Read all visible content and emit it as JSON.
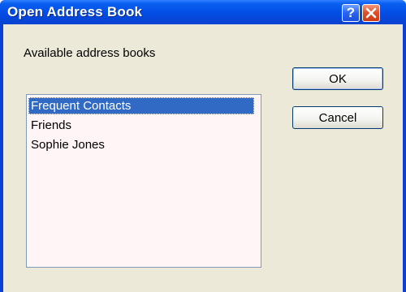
{
  "window": {
    "title": "Open Address Book"
  },
  "titlebar": {
    "help_glyph": "?",
    "close_icon": "close-icon",
    "help_icon": "question-icon"
  },
  "dialog": {
    "caption": "Available address books",
    "list": {
      "items": [
        "Frequent Contacts",
        "Friends",
        "Sophie Jones"
      ],
      "selected_index": 0
    },
    "buttons": {
      "ok": "OK",
      "cancel": "Cancel"
    }
  },
  "colors": {
    "titlebar": "#0451e8",
    "selection": "#316ac5",
    "dialog_bg": "#ece9d8",
    "list_bg": "#fff5f7",
    "close_button": "#e0522a"
  }
}
